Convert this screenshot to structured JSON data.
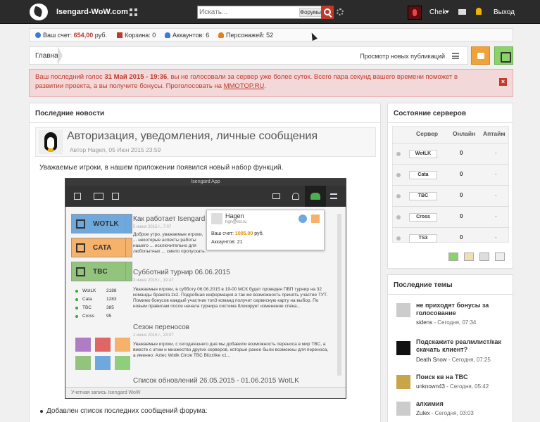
{
  "header": {
    "site_name": "Isengard-WoW.com",
    "search_placeholder": "Искать...",
    "search_scope": "Форумы",
    "user_name": "Chek",
    "logout": "Выход"
  },
  "stats": {
    "balance_label": "Ваш счет:",
    "balance_value": "654,00",
    "balance_unit": "руб.",
    "cart": "Корзина: 0",
    "accounts": "Аккаунтов: 6",
    "characters": "Персонажей: 52"
  },
  "breadcrumb": {
    "home": "Главная",
    "new_posts": "Просмотр новых публикаций"
  },
  "alert": {
    "part1": "Ваш последний голос ",
    "date": "31 Май 2015 - 19:36",
    "part2": ", вы не голосовали за сервер уже более суток. Всего пара секунд вашего времени поможет в развитии проекта, а вы получите бонусы. Проголосовать на ",
    "link": "MMOTOP.RU",
    "part3": "."
  },
  "news": {
    "panel_title": "Последние новости",
    "post_title": "Авторизация, уведомления, личные сообщения",
    "meta_prefix": "Автор",
    "meta_author": "Hagen",
    "meta_date": ", 05 Июн 2015 23:59",
    "intro": "Уважаемые игроки, в нашем приложении появился новый набор функций.",
    "bullet": "Добавлен список последних сообщений форума:"
  },
  "app": {
    "title": "Isengard App",
    "side_buttons": [
      {
        "label": "WOTLK",
        "color": "#6fa8dc"
      },
      {
        "label": "CATA",
        "color": "#f6b26b"
      },
      {
        "label": "TBC",
        "color": "#93c47d"
      }
    ],
    "mini_servers": [
      {
        "name": "WotLK",
        "count": "2188"
      },
      {
        "name": "Cata",
        "count": "1283"
      },
      {
        "name": "TBC",
        "count": "385"
      },
      {
        "name": "Cross",
        "count": "95"
      }
    ],
    "articles": [
      {
        "title": "Как работает Isengard",
        "date": "5 июня 2015 г., 7:07",
        "text": "Доброе утро, уважаемые игроки, ... некоторые аспекты работы нашего ... исключительно для любопытных ... смело пропускать."
      },
      {
        "title": "Субботний турнир 06.06.2015",
        "date": "3 июня 2015 г., 19:47",
        "text": "Уважаемые игроки, в субботу 06.06.2015 в 19-00 МСК будет проведен ПВП турнир на 32 команды бракета 2х2. Подробная информация а так же возможность принять участие ТУТ. Помимо бонусов каждый участник топ3 команд получит сервисную карту на выбор.  По новым правилам после начала турнира система блокирует изменение спека..."
      },
      {
        "title": "Сезон переносов",
        "date": "2 июня 2015 г., 23:07",
        "text": "Уважаемые игроки, с сегодняшнего дня мы добавили возможность переноса в мир TBC, а вместе с этим и множество других серверов, которые ранее были возможны для переноса, а именно:  Aztec Wotlk  Circle TBC Blizzlike x1..."
      },
      {
        "title": "Список обновлений 26.05.2015 - 01.06.2015 WotLK",
        "date": "",
        "text": ""
      }
    ],
    "popup": {
      "name": "Hagen",
      "email": "hgn@list.ru",
      "balance_label": "Ваш счет:",
      "balance_value": "1005.00",
      "balance_unit": "руб.",
      "accounts": "Аккаунтов: 21"
    },
    "status": "Учетная запись Isengard WoW"
  },
  "servers": {
    "panel_title": "Состояние серверов",
    "col_server": "Сервер",
    "col_online": "Онлайн",
    "col_uptime": "Аптайм",
    "rows": [
      {
        "name": "WotLK",
        "online": "0",
        "uptime": "-"
      },
      {
        "name": "Cata",
        "online": "0",
        "uptime": "-"
      },
      {
        "name": "TBC",
        "online": "0",
        "uptime": "-"
      },
      {
        "name": "Cross",
        "online": "0",
        "uptime": "-"
      },
      {
        "name": "TS3",
        "online": "0",
        "uptime": "-"
      }
    ]
  },
  "topics": {
    "panel_title": "Последние темы",
    "items": [
      {
        "title": "не приходят бонусы за голосование",
        "author": "sidens",
        "time": " - Сегодня, 07:34"
      },
      {
        "title": "Подскажите реалмлист/как скачать клиент?",
        "author": "Death Snow",
        "time": " - Сегодня, 07:25"
      },
      {
        "title": "Поиск кв на TBC",
        "author": "unknown43",
        "time": " - Сегодня, 05:42"
      },
      {
        "title": "алхимия",
        "author": "Zulex",
        "time": " - Сегодня, 03:03"
      }
    ]
  },
  "colors": {
    "accent": "#c0392b",
    "alert_bg": "#f2d8d8",
    "topbar": "#2b2b2b"
  }
}
